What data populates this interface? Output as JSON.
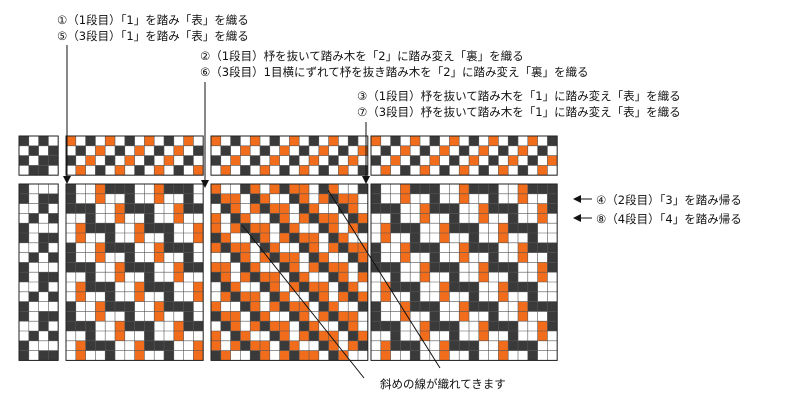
{
  "annotations": {
    "step1": "①（1段目）「1」を踏み「表」を織る",
    "step5": "⑤（3段目）「1」を踏み「表」を織る",
    "step2": "②（1段目）杼を抜いて踏み木を「2」に踏み変え「裏」を織る",
    "step6": "⑥（3段目）1目横にずれて杼を抜き踏み木を「2」に踏み変え「裏」を織る",
    "step3": "③（1段目）杼を抜いて踏み木を「1」に踏み変え「表」を織る",
    "step7": "⑦（3段目）杼を抜いて踏み木を「1」に踏み変え「表」を織る",
    "step4": "④（2段目）「3」を踏み帰る",
    "step8": "⑧（4段目）「4」を踏み帰る",
    "diagonal_note": "斜めの線が織れてきます"
  },
  "colors": {
    "dark": "#3a3a3a",
    "orange": "#f26d1b",
    "white": "#ffffff",
    "grid": "#555555",
    "line": "#111111"
  }
}
